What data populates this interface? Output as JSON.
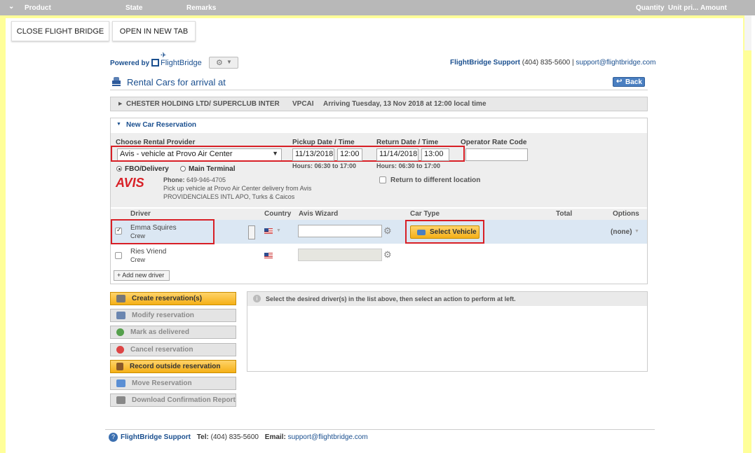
{
  "topbar": {
    "product": "Product",
    "state": "State",
    "remarks": "Remarks",
    "quantity": "Quantity",
    "unit_price": "Unit pri...",
    "amount": "Amount"
  },
  "toolbar": {
    "close_label": "CLOSE FLIGHT BRIDGE",
    "open_label": "OPEN IN NEW TAB"
  },
  "brand": {
    "powered_by": "Powered by",
    "logo_text": "FlightBridge",
    "support_name": "FlightBridge Support",
    "support_phone": "(404) 835-5600",
    "separator": "|",
    "support_email": "support@flightbridge.com"
  },
  "page": {
    "title": "Rental Cars for arrival at",
    "back_label": "Back"
  },
  "flight": {
    "company": "CHESTER HOLDING LTD/ SUPERCLUB INTER",
    "code": "VPCAI",
    "arrival": "Arriving Tuesday, 13 Nov 2018 at 12:00 local time"
  },
  "reservation": {
    "section_title": "New Car Reservation",
    "provider_label": "Choose Rental Provider",
    "provider_value": "Avis - vehicle at Provo Air Center",
    "pickup_label": "Pickup Date / Time",
    "pickup_date": "11/13/2018",
    "pickup_time": "12:00",
    "pickup_hours": "Hours: 06:30 to 17:00",
    "return_label": "Return Date / Time",
    "return_date": "11/14/2018",
    "return_time": "13:00",
    "return_hours": "Hours: 06:30 to 17:00",
    "rate_code_label": "Operator Rate Code",
    "rate_code_value": "",
    "option_fbo": "FBO/Delivery",
    "option_terminal": "Main Terminal",
    "vendor_logo": "AVIS",
    "phone_label": "Phone:",
    "phone_value": "649-946-4705",
    "pickup_note": "Pick up vehicle at Provo Air Center delivery from Avis",
    "location_note": "PROVIDENCIALES INTL APO, Turks & Caicos",
    "return_diff_label": "Return to different location"
  },
  "drivers_table": {
    "headers": {
      "driver": "Driver",
      "country": "Country",
      "wizard": "Avis Wizard",
      "car_type": "Car Type",
      "total": "Total",
      "options": "Options"
    },
    "rows": [
      {
        "name": "Emma Squires",
        "role": "Crew",
        "checked": true,
        "select_vehicle": "Select Vehicle",
        "option_value": "(none)"
      },
      {
        "name": "Ries Vriend",
        "role": "Crew",
        "checked": false
      }
    ],
    "add_driver": "+ Add new driver"
  },
  "actions": [
    {
      "label": "Create reservation(s)",
      "enabled": true
    },
    {
      "label": "Modify reservation",
      "enabled": false
    },
    {
      "label": "Mark as delivered",
      "enabled": false
    },
    {
      "label": "Cancel reservation",
      "enabled": false
    },
    {
      "label": "Record outside reservation",
      "enabled": true
    },
    {
      "label": "Move Reservation",
      "enabled": false
    },
    {
      "label": "Download Confirmation Report",
      "enabled": false
    }
  ],
  "info_message": "Select the desired driver(s) in the list above, then select an action to perform at left.",
  "footer": {
    "support_name": "FlightBridge Support",
    "tel_label": "Tel:",
    "tel_value": "(404) 835-5600",
    "email_label": "Email:",
    "email_value": "support@flightbridge.com"
  },
  "colors": {
    "accent_blue": "#1a4f8f",
    "highlight_red": "#d81f26",
    "action_yellow": "#f5b017",
    "frame_yellow": "#ffff99"
  }
}
